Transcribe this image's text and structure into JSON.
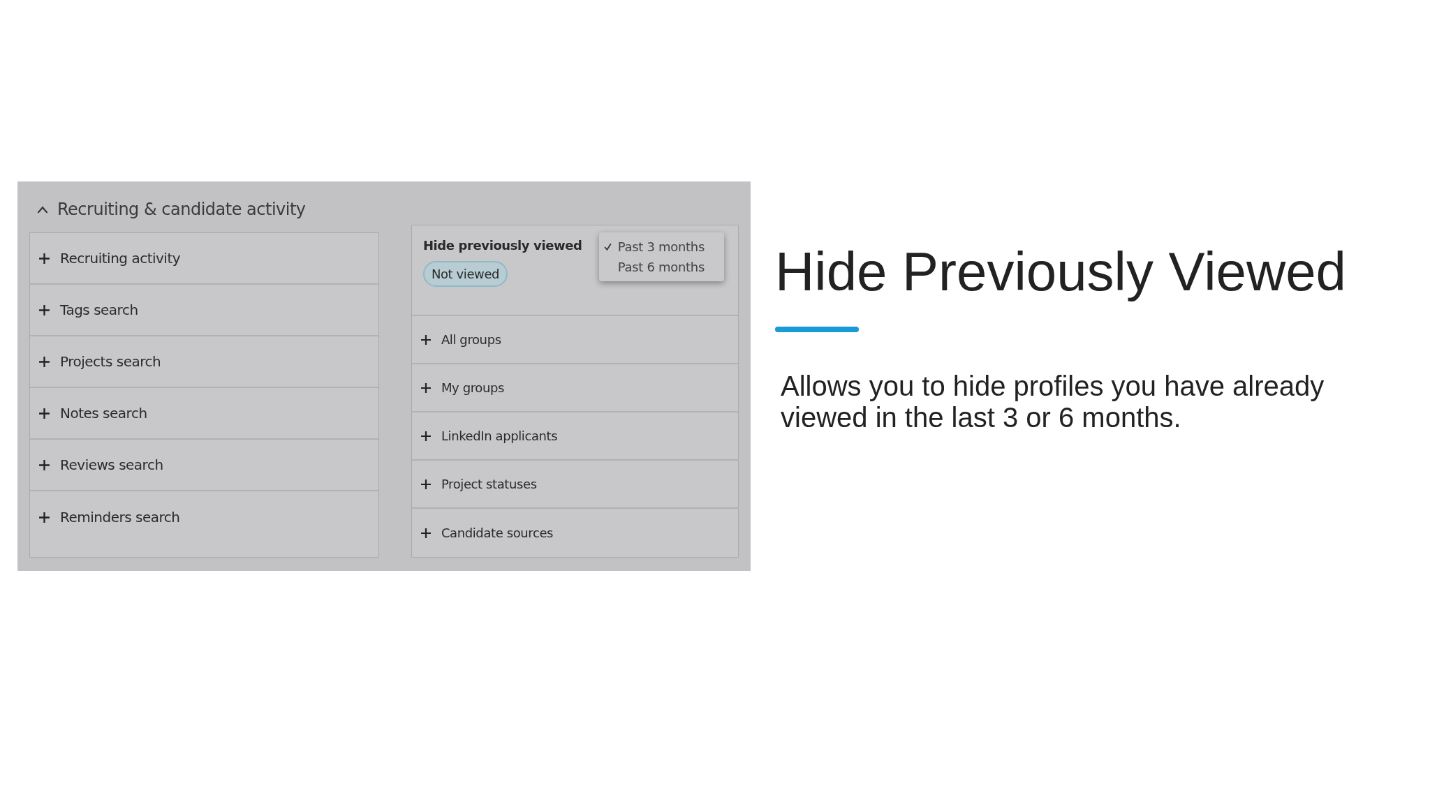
{
  "screenshot": {
    "section": {
      "title": "Recruiting & candidate activity",
      "expanded": true
    },
    "left_filters": [
      {
        "label": "Recruiting activity"
      },
      {
        "label": "Tags search"
      },
      {
        "label": "Projects search"
      },
      {
        "label": "Notes search"
      },
      {
        "label": "Reviews search"
      },
      {
        "label": "Reminders search"
      }
    ],
    "hide_panel": {
      "title": "Hide previously viewed",
      "chip": "Not viewed",
      "menu": [
        {
          "label": "Past 3 months",
          "selected": true
        },
        {
          "label": "Past 6 months",
          "selected": false
        }
      ]
    },
    "right_filters": [
      {
        "label": "All groups"
      },
      {
        "label": "My groups"
      },
      {
        "label": "LinkedIn applicants"
      },
      {
        "label": "Project statuses"
      },
      {
        "label": "Candidate sources"
      }
    ]
  },
  "slide": {
    "title": "Hide Previously Viewed",
    "body": "Allows you to hide profiles you have already viewed in the last 3 or 6 months."
  }
}
